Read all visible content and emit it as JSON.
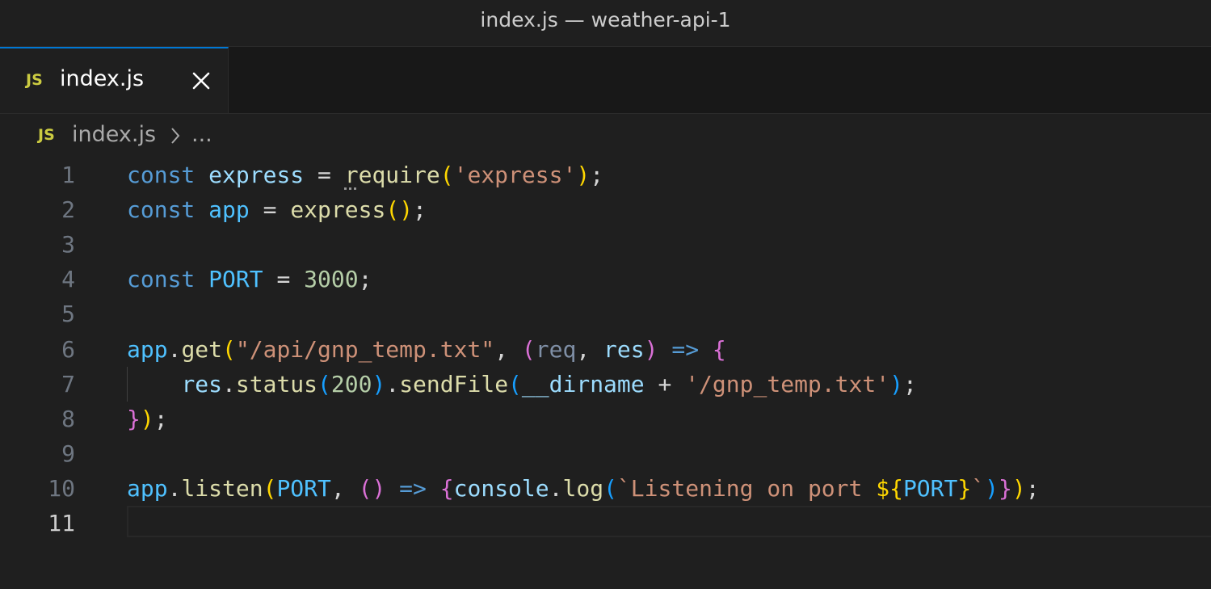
{
  "window": {
    "title": "index.js — weather-api-1"
  },
  "tab": {
    "badge": "JS",
    "label": "index.js",
    "close_icon": "close-icon"
  },
  "breadcrumb": {
    "badge": "JS",
    "file": "index.js",
    "more": "..."
  },
  "editor": {
    "active_line": 11,
    "lines": [
      {
        "num": "1"
      },
      {
        "num": "2"
      },
      {
        "num": "3"
      },
      {
        "num": "4"
      },
      {
        "num": "5"
      },
      {
        "num": "6"
      },
      {
        "num": "7"
      },
      {
        "num": "8"
      },
      {
        "num": "9"
      },
      {
        "num": "10"
      },
      {
        "num": "11"
      }
    ],
    "tokens": {
      "l1": [
        "const",
        " express",
        " = ",
        "r",
        "equire",
        "(",
        "'express'",
        ")",
        ";"
      ],
      "l2": [
        "const",
        " app",
        " = ",
        "express",
        "(",
        ")",
        ";"
      ],
      "l4": [
        "const",
        " PORT",
        " = ",
        "3000",
        ";"
      ],
      "l6": [
        "app",
        ".",
        "get",
        "(",
        "\"/api/gnp_temp.txt\"",
        ", ",
        "(",
        "req",
        ", ",
        "res",
        ")",
        " => ",
        "{"
      ],
      "l7": [
        "    ",
        "res",
        ".",
        "status",
        "(",
        "200",
        ")",
        ".",
        "sendFile",
        "(",
        "__dirname",
        " + ",
        "'/gnp_temp.txt'",
        ")",
        ";"
      ],
      "l8": [
        "}",
        ")",
        ";"
      ],
      "l10": [
        "app",
        ".",
        "listen",
        "(",
        "PORT",
        ", ",
        "(",
        ")",
        " => ",
        "{",
        "console",
        ".",
        "log",
        "(",
        "`Listening on port ",
        "${",
        "PORT",
        "}",
        "`",
        ")",
        "}",
        ")",
        ";"
      ]
    }
  },
  "colors": {
    "background": "#1f1f1f",
    "tab_accent": "#0078d4",
    "js_badge": "#cbcb41"
  }
}
